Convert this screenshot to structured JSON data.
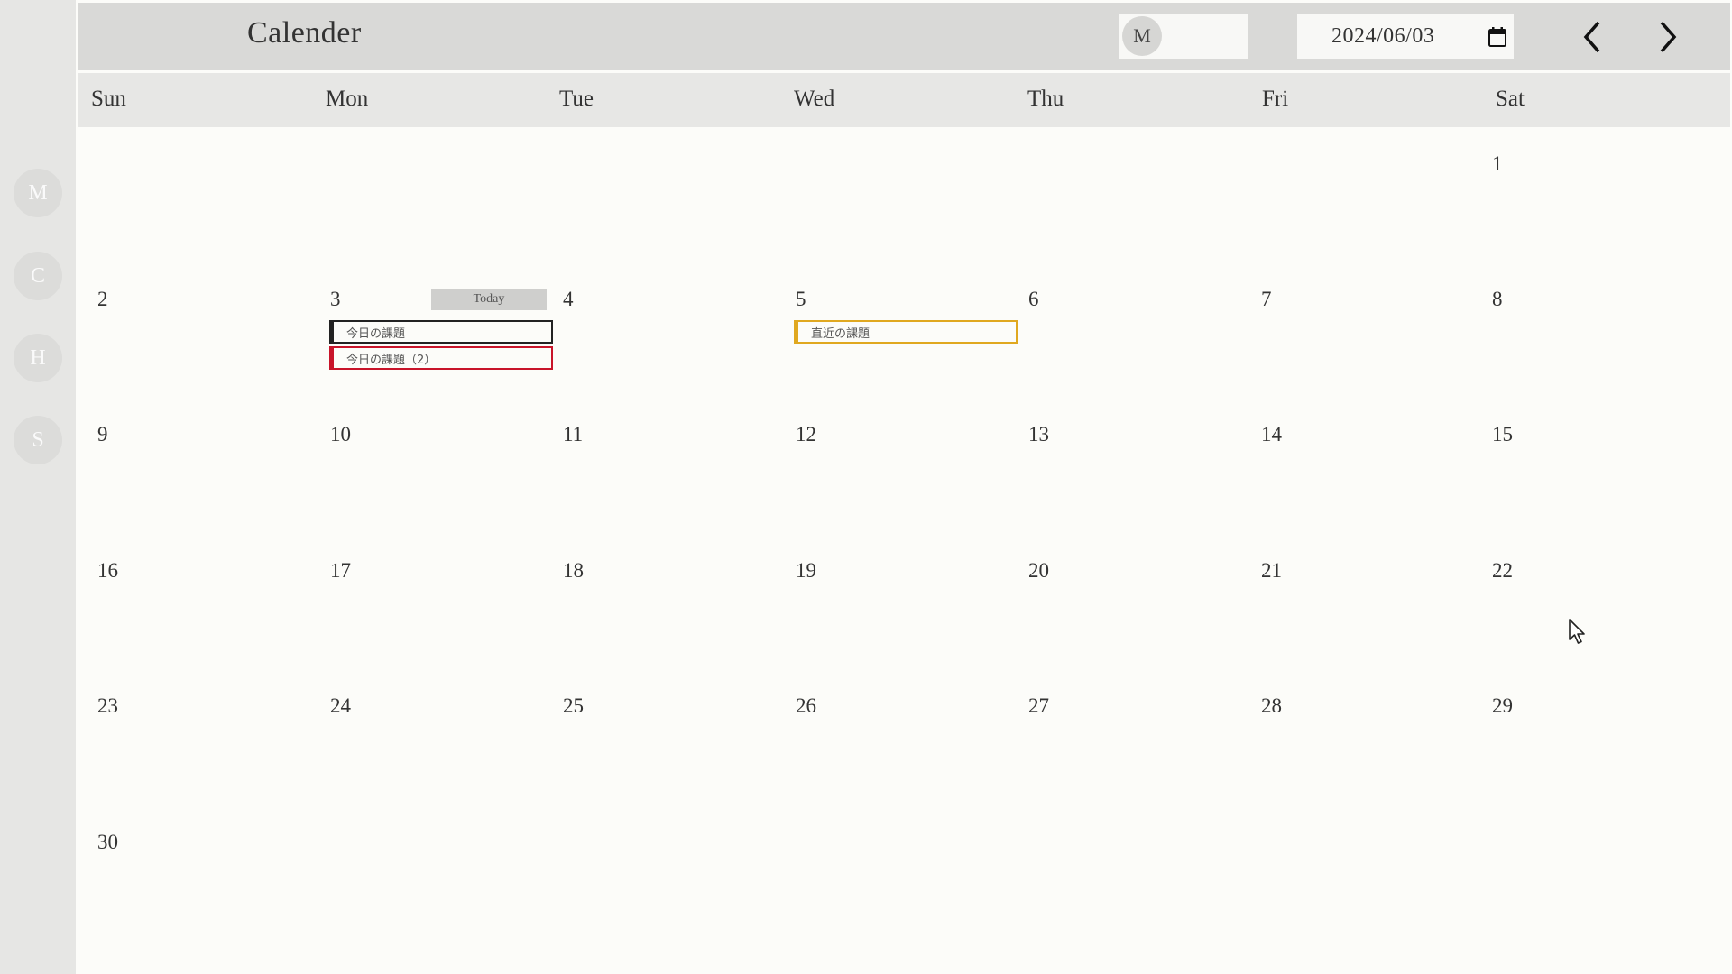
{
  "app": {
    "title": "Calender"
  },
  "sidebar": {
    "items": [
      {
        "label": "M"
      },
      {
        "label": "C"
      },
      {
        "label": "H"
      },
      {
        "label": "S"
      }
    ]
  },
  "header": {
    "user_initial": "M",
    "date_value": "2024/06/03"
  },
  "weekdays": [
    "Sun",
    "Mon",
    "Tue",
    "Wed",
    "Thu",
    "Fri",
    "Sat"
  ],
  "calendar": {
    "days": [
      "1",
      "2",
      "3",
      "4",
      "5",
      "6",
      "7",
      "8",
      "9",
      "10",
      "11",
      "12",
      "13",
      "14",
      "15",
      "16",
      "17",
      "18",
      "19",
      "20",
      "21",
      "22",
      "23",
      "24",
      "25",
      "26",
      "27",
      "28",
      "29",
      "30"
    ],
    "today_label": "Today",
    "tasks": [
      {
        "title": "今日の課題",
        "color": "#222222"
      },
      {
        "title": "今日の課題（2）",
        "color": "#c8142a"
      },
      {
        "title": "直近の課題",
        "color": "#e0a820"
      }
    ]
  },
  "colors": {
    "sidebar_bg": "#e6e6e4",
    "header_bg": "#d9d9d7",
    "page_bg": "#fcfcf9"
  }
}
